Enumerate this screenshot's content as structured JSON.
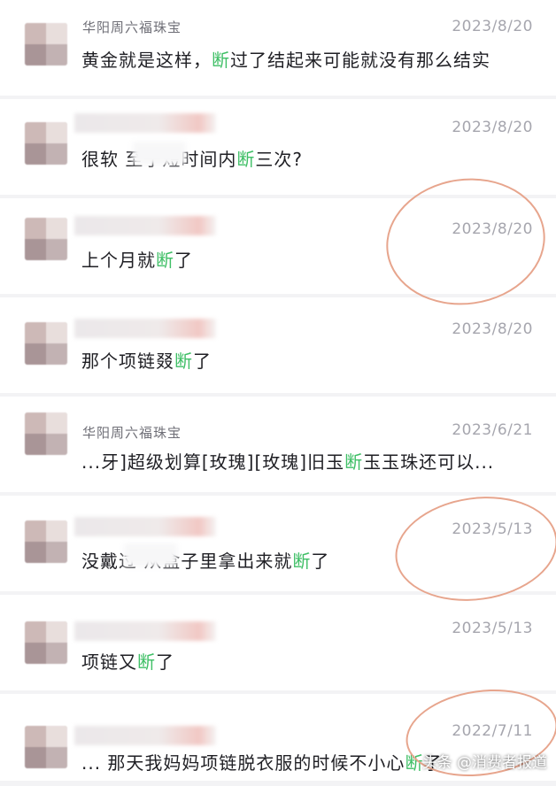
{
  "comments": [
    {
      "shop": "华阳周六福珠宝",
      "date": "2023/8/20",
      "pre": "黄金就是这样，",
      "hl": "断",
      "post": "过了结起来可能就没有那么结实"
    },
    {
      "shop": "",
      "date": "2023/8/20",
      "pre": "很软  至于短时间内",
      "hl": "断",
      "post": "三次?"
    },
    {
      "shop": "",
      "date": "2023/8/20",
      "pre": "上个月就",
      "hl": "断",
      "post": "了"
    },
    {
      "shop": "",
      "date": "2023/8/20",
      "pre": "那个项链叕",
      "hl": "断",
      "post": "了"
    },
    {
      "shop": "华阳周六福珠宝",
      "date": "2023/6/21",
      "pre": "...牙]超级划算[玫瑰][玫瑰]旧玉",
      "hl": "断",
      "post": "玉玉珠还可以..."
    },
    {
      "shop": "",
      "date": "2023/5/13",
      "pre": "没戴过  从盒子里拿出来就",
      "hl": "断",
      "post": "了"
    },
    {
      "shop": "",
      "date": "2023/5/13",
      "pre": "项链又",
      "hl": "断",
      "post": "了"
    },
    {
      "shop": "",
      "date": "2022/7/11",
      "pre": "...  那天我妈妈项链脱衣服的时候不小心",
      "hl": "断",
      "post": "了"
    }
  ],
  "watermark": "头条 @消费者报道"
}
